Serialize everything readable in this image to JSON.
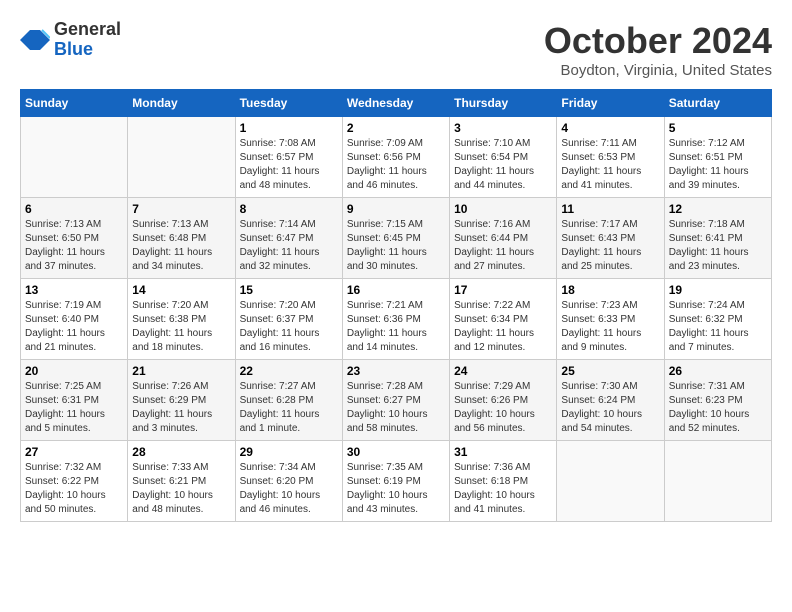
{
  "header": {
    "logo_general": "General",
    "logo_blue": "Blue",
    "month_title": "October 2024",
    "location": "Boydton, Virginia, United States"
  },
  "calendar": {
    "days_of_week": [
      "Sunday",
      "Monday",
      "Tuesday",
      "Wednesday",
      "Thursday",
      "Friday",
      "Saturday"
    ],
    "weeks": [
      [
        {
          "day": "",
          "info": ""
        },
        {
          "day": "",
          "info": ""
        },
        {
          "day": "1",
          "info": "Sunrise: 7:08 AM\nSunset: 6:57 PM\nDaylight: 11 hours and 48 minutes."
        },
        {
          "day": "2",
          "info": "Sunrise: 7:09 AM\nSunset: 6:56 PM\nDaylight: 11 hours and 46 minutes."
        },
        {
          "day": "3",
          "info": "Sunrise: 7:10 AM\nSunset: 6:54 PM\nDaylight: 11 hours and 44 minutes."
        },
        {
          "day": "4",
          "info": "Sunrise: 7:11 AM\nSunset: 6:53 PM\nDaylight: 11 hours and 41 minutes."
        },
        {
          "day": "5",
          "info": "Sunrise: 7:12 AM\nSunset: 6:51 PM\nDaylight: 11 hours and 39 minutes."
        }
      ],
      [
        {
          "day": "6",
          "info": "Sunrise: 7:13 AM\nSunset: 6:50 PM\nDaylight: 11 hours and 37 minutes."
        },
        {
          "day": "7",
          "info": "Sunrise: 7:13 AM\nSunset: 6:48 PM\nDaylight: 11 hours and 34 minutes."
        },
        {
          "day": "8",
          "info": "Sunrise: 7:14 AM\nSunset: 6:47 PM\nDaylight: 11 hours and 32 minutes."
        },
        {
          "day": "9",
          "info": "Sunrise: 7:15 AM\nSunset: 6:45 PM\nDaylight: 11 hours and 30 minutes."
        },
        {
          "day": "10",
          "info": "Sunrise: 7:16 AM\nSunset: 6:44 PM\nDaylight: 11 hours and 27 minutes."
        },
        {
          "day": "11",
          "info": "Sunrise: 7:17 AM\nSunset: 6:43 PM\nDaylight: 11 hours and 25 minutes."
        },
        {
          "day": "12",
          "info": "Sunrise: 7:18 AM\nSunset: 6:41 PM\nDaylight: 11 hours and 23 minutes."
        }
      ],
      [
        {
          "day": "13",
          "info": "Sunrise: 7:19 AM\nSunset: 6:40 PM\nDaylight: 11 hours and 21 minutes."
        },
        {
          "day": "14",
          "info": "Sunrise: 7:20 AM\nSunset: 6:38 PM\nDaylight: 11 hours and 18 minutes."
        },
        {
          "day": "15",
          "info": "Sunrise: 7:20 AM\nSunset: 6:37 PM\nDaylight: 11 hours and 16 minutes."
        },
        {
          "day": "16",
          "info": "Sunrise: 7:21 AM\nSunset: 6:36 PM\nDaylight: 11 hours and 14 minutes."
        },
        {
          "day": "17",
          "info": "Sunrise: 7:22 AM\nSunset: 6:34 PM\nDaylight: 11 hours and 12 minutes."
        },
        {
          "day": "18",
          "info": "Sunrise: 7:23 AM\nSunset: 6:33 PM\nDaylight: 11 hours and 9 minutes."
        },
        {
          "day": "19",
          "info": "Sunrise: 7:24 AM\nSunset: 6:32 PM\nDaylight: 11 hours and 7 minutes."
        }
      ],
      [
        {
          "day": "20",
          "info": "Sunrise: 7:25 AM\nSunset: 6:31 PM\nDaylight: 11 hours and 5 minutes."
        },
        {
          "day": "21",
          "info": "Sunrise: 7:26 AM\nSunset: 6:29 PM\nDaylight: 11 hours and 3 minutes."
        },
        {
          "day": "22",
          "info": "Sunrise: 7:27 AM\nSunset: 6:28 PM\nDaylight: 11 hours and 1 minute."
        },
        {
          "day": "23",
          "info": "Sunrise: 7:28 AM\nSunset: 6:27 PM\nDaylight: 10 hours and 58 minutes."
        },
        {
          "day": "24",
          "info": "Sunrise: 7:29 AM\nSunset: 6:26 PM\nDaylight: 10 hours and 56 minutes."
        },
        {
          "day": "25",
          "info": "Sunrise: 7:30 AM\nSunset: 6:24 PM\nDaylight: 10 hours and 54 minutes."
        },
        {
          "day": "26",
          "info": "Sunrise: 7:31 AM\nSunset: 6:23 PM\nDaylight: 10 hours and 52 minutes."
        }
      ],
      [
        {
          "day": "27",
          "info": "Sunrise: 7:32 AM\nSunset: 6:22 PM\nDaylight: 10 hours and 50 minutes."
        },
        {
          "day": "28",
          "info": "Sunrise: 7:33 AM\nSunset: 6:21 PM\nDaylight: 10 hours and 48 minutes."
        },
        {
          "day": "29",
          "info": "Sunrise: 7:34 AM\nSunset: 6:20 PM\nDaylight: 10 hours and 46 minutes."
        },
        {
          "day": "30",
          "info": "Sunrise: 7:35 AM\nSunset: 6:19 PM\nDaylight: 10 hours and 43 minutes."
        },
        {
          "day": "31",
          "info": "Sunrise: 7:36 AM\nSunset: 6:18 PM\nDaylight: 10 hours and 41 minutes."
        },
        {
          "day": "",
          "info": ""
        },
        {
          "day": "",
          "info": ""
        }
      ]
    ]
  }
}
